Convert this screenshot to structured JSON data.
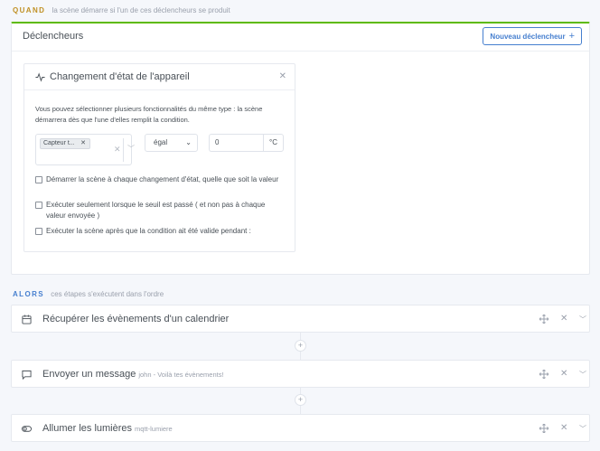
{
  "quand": {
    "keyword": "QUAND",
    "description": "la scène démarre si l'un de ces déclencheurs se produit"
  },
  "triggers_card": {
    "title": "Déclencheurs",
    "new_button_label": "Nouveau déclencheur",
    "new_button_icon": "plus-icon"
  },
  "trigger": {
    "icon": "activity-icon",
    "title": "Changement d'état de l'appareil",
    "description": "Vous pouvez sélectionner plusieurs fonctionnalités du même type : la scène démarrera dès que l'une d'elles remplit la condition.",
    "selected_feature": "Capteur t...",
    "operator": "égal",
    "value": "0",
    "unit": "°C",
    "options": [
      {
        "label": "Démarrer la scène à chaque changement d'état, quelle que soit la valeur",
        "checked": false
      },
      {
        "label": "Exécuter seulement lorsque le seuil est passé ( et non pas à chaque valeur envoyée )",
        "checked": false
      },
      {
        "label": "Exécuter la scène après que la condition ait été valide pendant :",
        "checked": false
      }
    ]
  },
  "alors": {
    "keyword": "ALORS",
    "description": "ces étapes s'exécutent dans l'ordre"
  },
  "steps": [
    {
      "icon": "calendar-icon",
      "title": "Récupérer les évènements d'un calendrier",
      "subtitle": ""
    },
    {
      "icon": "message-icon",
      "title": "Envoyer un message",
      "subtitle": "john - Voilà tes évènements!"
    },
    {
      "icon": "toggle-icon",
      "title": "Allumer les lumières",
      "subtitle": "mqtt-lumiere"
    }
  ],
  "colors": {
    "quand": "#c09024",
    "alors": "#467fcf",
    "accent_green": "#5eba00",
    "primary": "#467fcf"
  }
}
